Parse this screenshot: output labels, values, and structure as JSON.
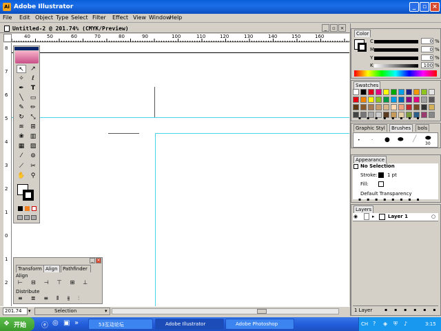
{
  "app": {
    "title": "Adobe Illustrator"
  },
  "menu": [
    "File",
    "Edit",
    "Object",
    "Type",
    "Select",
    "Filter",
    "Effect",
    "View",
    "Window",
    "Help"
  ],
  "document": {
    "title": "Untitled-2 @ 201.74% (CMYK/Preview)"
  },
  "ruler": {
    "ticks": [
      "40",
      "50",
      "60",
      "70",
      "80",
      "90",
      "100",
      "110",
      "120",
      "130",
      "140",
      "150",
      "160"
    ]
  },
  "vruler": {
    "ticks": [
      "8",
      "7",
      "6",
      "5",
      "4",
      "3",
      "2",
      "1",
      "0",
      "1",
      "2",
      "3"
    ]
  },
  "color_panel": {
    "tab": "Color",
    "channels": [
      {
        "label": "C",
        "value": "0",
        "unit": "%"
      },
      {
        "label": "M",
        "value": "0",
        "unit": "%"
      },
      {
        "label": "Y",
        "value": "0",
        "unit": "%"
      },
      {
        "label": "K",
        "value": "100",
        "unit": "%"
      }
    ]
  },
  "swatches_panel": {
    "tab": "Swatches"
  },
  "brushes_panel": {
    "tabs": [
      "Graphic Styl",
      "Brushes",
      "bols"
    ],
    "brush_size": "30"
  },
  "appearance_panel": {
    "tab": "Appearance",
    "selection": "No Selection",
    "stroke_label": "Stroke:",
    "stroke_value": "1 pt",
    "fill_label": "Fill:",
    "transparency": "Default Transparency"
  },
  "layers_panel": {
    "tab": "Layers",
    "layer_name": "Layer 1",
    "footer": "1 Layer"
  },
  "align_panel": {
    "tabs": [
      "Transform",
      "Align",
      "Pathfinder"
    ],
    "align_label": "Align",
    "distribute_label": "Distribute"
  },
  "status": {
    "zoom": "201.74",
    "tool": "Selection"
  },
  "taskbar": {
    "start": "开始",
    "buttons": [
      "53互动论坛",
      "Adobe Illustrator",
      "Adobe Photoshop"
    ],
    "ime": "CH",
    "time": "3:15"
  },
  "colors": {
    "title_bar": "#0a5fd8",
    "guide": "#4dd4ea",
    "taskbar": "#245edc"
  }
}
